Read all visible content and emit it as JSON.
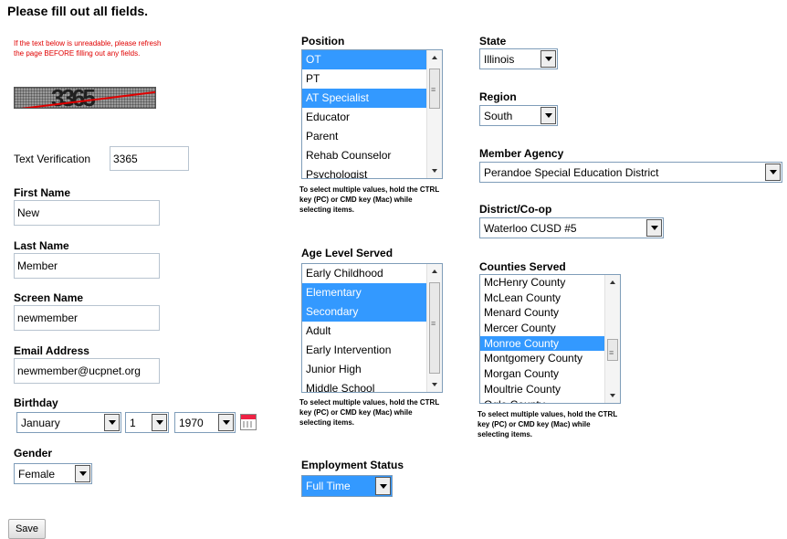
{
  "page_title": "Please fill out all fields.",
  "captcha": {
    "warning": "If the text below is unreadable, please refresh the page BEFORE filling out any fields.",
    "digits": "3365"
  },
  "text_verification": {
    "label": "Text Verification",
    "value": "3365"
  },
  "first_name": {
    "label": "First Name",
    "value": "New"
  },
  "last_name": {
    "label": "Last Name",
    "value": "Member"
  },
  "screen_name": {
    "label": "Screen Name",
    "value": "newmember"
  },
  "email": {
    "label": "Email Address",
    "value": "newmember@ucpnet.org"
  },
  "birthday": {
    "label": "Birthday",
    "month": "January",
    "day": "1",
    "year": "1970"
  },
  "gender": {
    "label": "Gender",
    "value": "Female"
  },
  "save_label": "Save",
  "position": {
    "label": "Position",
    "options": [
      {
        "text": "OT",
        "selected": true
      },
      {
        "text": "PT",
        "selected": false
      },
      {
        "text": "AT Specialist",
        "selected": true
      },
      {
        "text": "Educator",
        "selected": false
      },
      {
        "text": "Parent",
        "selected": false
      },
      {
        "text": "Rehab Counselor",
        "selected": false
      },
      {
        "text": "Psychologist",
        "selected": false
      }
    ],
    "hint": "To select multiple values, hold the CTRL key (PC) or CMD key (Mac) while selecting items."
  },
  "age_level": {
    "label": "Age Level Served",
    "options": [
      {
        "text": "Early Childhood",
        "selected": false
      },
      {
        "text": "Elementary",
        "selected": true
      },
      {
        "text": "Secondary",
        "selected": true
      },
      {
        "text": "Adult",
        "selected": false
      },
      {
        "text": "Early Intervention",
        "selected": false
      },
      {
        "text": "Junior High",
        "selected": false
      },
      {
        "text": "Middle School",
        "selected": false
      }
    ],
    "hint": "To select multiple values, hold the CTRL key (PC) or CMD key (Mac) while selecting items."
  },
  "employment_status": {
    "label": "Employment Status",
    "value": "Full Time"
  },
  "state": {
    "label": "State",
    "value": "Illinois"
  },
  "region": {
    "label": "Region",
    "value": "South"
  },
  "member_agency": {
    "label": "Member Agency",
    "value": "Perandoe Special Education District"
  },
  "district": {
    "label": "District/Co-op",
    "value": "Waterloo CUSD #5"
  },
  "counties": {
    "label": "Counties Served",
    "options": [
      {
        "text": "McHenry County",
        "selected": false
      },
      {
        "text": "McLean County",
        "selected": false
      },
      {
        "text": "Menard County",
        "selected": false
      },
      {
        "text": "Mercer County",
        "selected": false
      },
      {
        "text": "Monroe County",
        "selected": true
      },
      {
        "text": "Montgomery County",
        "selected": false
      },
      {
        "text": "Morgan County",
        "selected": false
      },
      {
        "text": "Moultrie County",
        "selected": false
      },
      {
        "text": "Ogle County",
        "selected": false
      }
    ],
    "hint": "To select multiple values, hold the CTRL key (PC) or CMD key (Mac) while selecting items."
  },
  "colors": {
    "selection": "#3399ff",
    "warning": "#e00000"
  }
}
